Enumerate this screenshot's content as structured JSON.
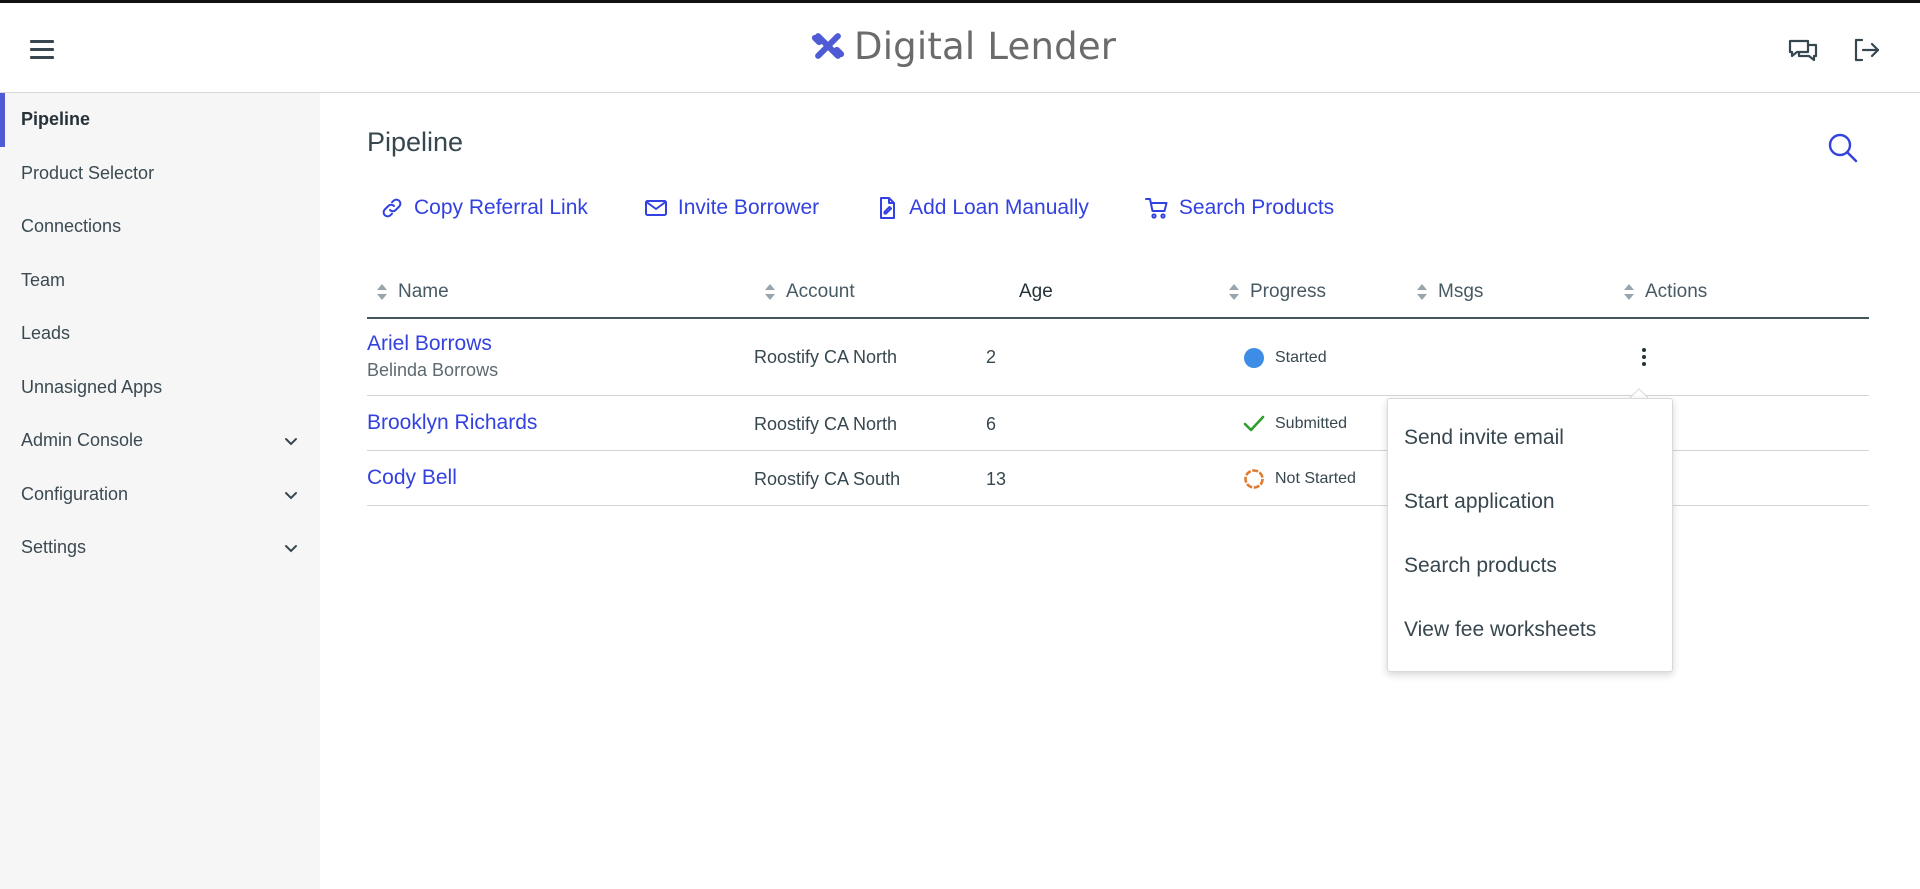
{
  "header": {
    "app_name": "Digital Lender",
    "brand_color": "#4f5bd5",
    "icons": [
      "menu-icon",
      "chat-icon",
      "logout-icon"
    ]
  },
  "sidebar": {
    "items": [
      {
        "label": "Pipeline",
        "active": true,
        "expandable": false
      },
      {
        "label": "Product Selector",
        "active": false,
        "expandable": false
      },
      {
        "label": "Connections",
        "active": false,
        "expandable": false
      },
      {
        "label": "Team",
        "active": false,
        "expandable": false
      },
      {
        "label": "Leads",
        "active": false,
        "expandable": false
      },
      {
        "label": "Unnasigned Apps",
        "active": false,
        "expandable": false
      },
      {
        "label": "Admin Console",
        "active": false,
        "expandable": true
      },
      {
        "label": "Configuration",
        "active": false,
        "expandable": true
      },
      {
        "label": "Settings",
        "active": false,
        "expandable": true
      }
    ]
  },
  "main": {
    "title": "Pipeline",
    "actions": [
      {
        "label": "Copy Referral Link",
        "icon": "link-icon"
      },
      {
        "label": "Invite Borrower",
        "icon": "mail-icon"
      },
      {
        "label": "Add Loan Manually",
        "icon": "document-icon"
      },
      {
        "label": "Search Products",
        "icon": "cart-icon"
      }
    ],
    "accent_color": "#3341e0"
  },
  "table": {
    "columns": [
      "Name",
      "Account",
      "Age",
      "Progress",
      "Msgs",
      "Actions"
    ],
    "rows": [
      {
        "name": "Ariel Borrows",
        "co_borrower": "Belinda Borrows",
        "account": "Roostify CA North",
        "age": "2",
        "progress": "Started",
        "status_icon": "started-dot-icon",
        "msgs": ""
      },
      {
        "name": "Brooklyn Richards",
        "co_borrower": "",
        "account": "Roostify CA North",
        "age": "6",
        "progress": "Submitted",
        "status_icon": "checkmark-icon",
        "msgs": ""
      },
      {
        "name": "Cody Bell",
        "co_borrower": "",
        "account": "Roostify CA South",
        "age": "13",
        "progress": "Not Started",
        "status_icon": "not-started-ring-icon",
        "msgs": ""
      }
    ],
    "status_colors": {
      "started": "#3d8de6",
      "submitted": "#2f9e2f",
      "not_started": "#e07a2e"
    }
  },
  "row_menu": {
    "items": [
      "Send invite email",
      "Start application",
      "Search products",
      "View fee worksheets"
    ]
  }
}
